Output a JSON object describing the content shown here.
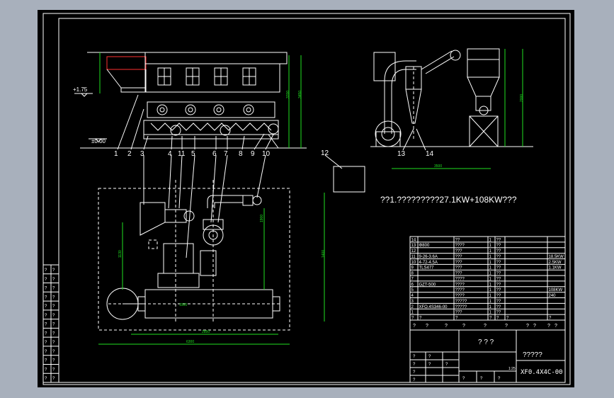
{
  "drawing": {
    "level_top": "+1.75",
    "level_ground": "±0.00",
    "callouts_top": [
      "1",
      "2",
      "3",
      "4",
      "11",
      "5",
      "6",
      "7",
      "8",
      "9",
      "10"
    ],
    "callouts_right": [
      "13",
      "14"
    ],
    "callout_12": "12",
    "power_note": "??1.?????????27.1KW+108KW???"
  },
  "parts_table": {
    "rows": [
      {
        "no": "14",
        "code": "",
        "name": "??",
        "qty": "1",
        "unit": "??",
        "power": ""
      },
      {
        "no": "13",
        "code": "Φ800",
        "name": "????",
        "qty": "1",
        "unit": "??",
        "power": ""
      },
      {
        "no": "12",
        "code": "",
        "name": "???",
        "qty": "1",
        "unit": "??",
        "power": ""
      },
      {
        "no": "11",
        "code": "9-26-3.6A",
        "name": "???",
        "qty": "1",
        "unit": "??",
        "power": "18.5KW"
      },
      {
        "no": "10",
        "code": "4-72-4.5A",
        "name": "???",
        "qty": "1",
        "unit": "??",
        "power": "2.5KW"
      },
      {
        "no": "9",
        "code": "TLS477",
        "name": "???",
        "qty": "1",
        "unit": "??",
        "power": "1.1KW"
      },
      {
        "no": "8",
        "code": "",
        "name": "???",
        "qty": "1",
        "unit": "??",
        "power": ""
      },
      {
        "no": "7",
        "code": "",
        "name": "????",
        "qty": "1",
        "unit": "??",
        "power": ""
      },
      {
        "no": "6",
        "code": "GZT-500",
        "name": "????",
        "qty": "1",
        "unit": "??",
        "power": ""
      },
      {
        "no": "5",
        "code": "",
        "name": "????",
        "qty": "1",
        "unit": "??",
        "power": "108KW"
      },
      {
        "no": "4",
        "code": "",
        "name": "????",
        "qty": "1",
        "unit": "??",
        "power": "240"
      },
      {
        "no": "3",
        "code": "",
        "name": "?????",
        "qty": "1",
        "unit": "??",
        "power": ""
      },
      {
        "no": "2",
        "code": "XFO.4S346-00",
        "name": "?????",
        "qty": "1",
        "unit": "??",
        "power": ""
      },
      {
        "no": "1",
        "code": "",
        "name": "???",
        "qty": "1",
        "unit": "??",
        "power": ""
      }
    ],
    "header": [
      "?",
      "?",
      "?",
      "?",
      "?",
      "?",
      "?"
    ]
  },
  "title_block": {
    "name_a": "? ? ?",
    "name_b": "?????",
    "drawing_no": "XF0.4X4C-00",
    "scale": "1:25",
    "small_marks": [
      "?",
      "?",
      "?",
      "?",
      "?",
      "?",
      "?",
      "?",
      "?",
      "?"
    ]
  },
  "left_rev_table": {
    "cells": [
      "?",
      "?",
      "?",
      "?",
      "?",
      "?",
      "?",
      "?",
      "?",
      "?",
      "?",
      "?",
      "?",
      "?",
      "?",
      "?",
      "?",
      "?",
      "?",
      "?",
      "?",
      "?",
      "?",
      "?",
      "?",
      "?"
    ]
  },
  "dims": {
    "d1": "3700",
    "d2": "1130",
    "d3": "2850",
    "d4": "1400",
    "d5": "3450",
    "d6": "6300",
    "d7": "3500",
    "d8": "2000",
    "d9": "1900",
    "d10": "1500"
  },
  "colors": {
    "background": "#000000",
    "frame": "#ffffff",
    "dimension": "#20e020",
    "leader": "#ffffff",
    "accent_red": "#ff3030",
    "accent_yellow": "#ffff00",
    "outer": "#a8b0bc"
  }
}
